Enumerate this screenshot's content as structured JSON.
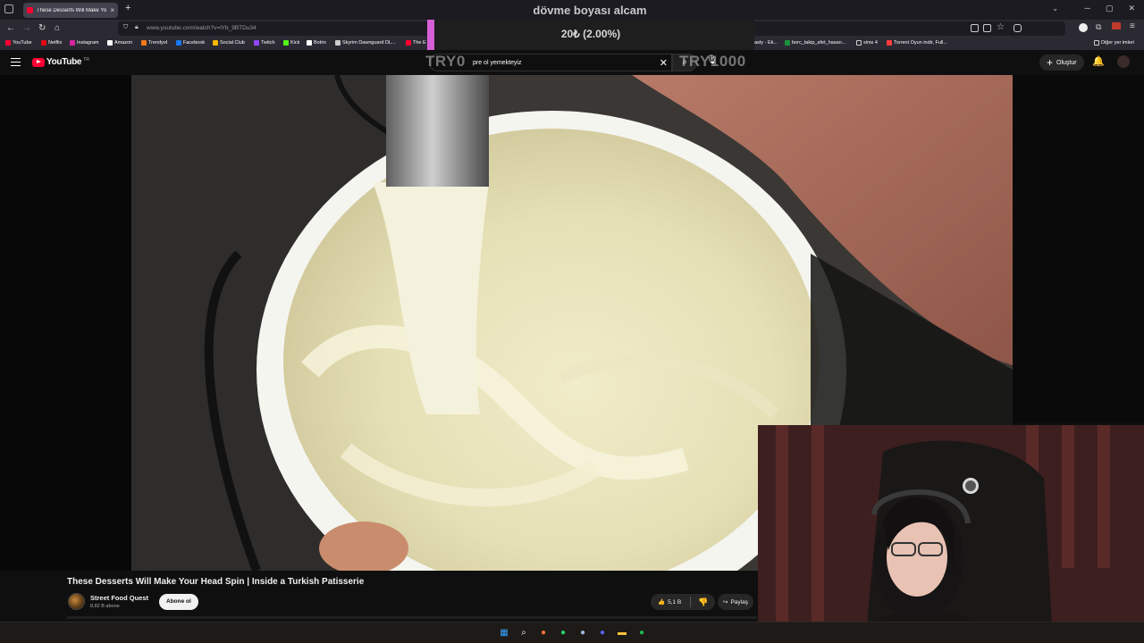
{
  "browser": {
    "tab_title": "These Desserts Will Make Your",
    "tab_close": "×",
    "new_tab": "+",
    "url_host": "www.youtube.com",
    "url_path": "/watch?v=lYb_9BTDu34",
    "window_controls": [
      "─",
      "▢",
      "✕"
    ],
    "nav": {
      "back": "←",
      "forward": "→",
      "reload": "↻",
      "home": "⌂"
    }
  },
  "bookmarks": [
    {
      "label": "YouTube",
      "color": "#ff0033"
    },
    {
      "label": "Netflix",
      "color": "#e50914"
    },
    {
      "label": "Instagram",
      "color": "#d6249f"
    },
    {
      "label": "Amazon",
      "color": "#ffffff"
    },
    {
      "label": "Trendyol",
      "color": "#f27a1a"
    },
    {
      "label": "Facebook",
      "color": "#1877f2"
    },
    {
      "label": "Social Club",
      "color": "#f5b700"
    },
    {
      "label": "Twitch",
      "color": "#9146ff"
    },
    {
      "label": "Kick",
      "color": "#53fc18"
    },
    {
      "label": "Botrix",
      "color": "#ffffff"
    },
    {
      "label": "Skyrim Dawnguard DL...",
      "color": "#cccccc"
    },
    {
      "label": "The E",
      "color": "#ff0033"
    },
    {
      "label": "asty - Ek...",
      "color": "#888888"
    },
    {
      "label": "borc_takip_afet_hasan...",
      "color": "#1d8f3a"
    },
    {
      "label": "sims 4",
      "color": "#cccccc"
    },
    {
      "label": "Torrent Oyun indir, Full...",
      "color": "#ff3b3b"
    }
  ],
  "other_bookmarks": "Diğer yer imleri",
  "youtube": {
    "logo_text": "YouTube",
    "logo_region": "TR",
    "search_value": "pre  ol yemekteyiz",
    "search_clear": "✕",
    "search_icon": "⌕",
    "mic_icon": "🎙",
    "create_label": "Oluştur",
    "create_plus": "+",
    "bell_icon": "🔔"
  },
  "overlay": {
    "title": "dövme boyası alcam",
    "donation_text": "20₺ (2.00%)",
    "progress_fraction": 0.02,
    "bar_color": "#d65fd6",
    "goal_start": "TRY0",
    "goal_end": "TRY1000"
  },
  "video": {
    "title": "These Desserts Will Make Your Head Spin | Inside a Turkish Patisserie",
    "channel_name": "Street Food Quest",
    "channel_subs": "8,82 B abone",
    "subscribe_label": "Abone ol",
    "like_count": "5,1 B",
    "like_icon": "👍",
    "dislike_icon": "👎",
    "share_label": "Paylaş",
    "share_icon": "↪"
  },
  "taskbar": {
    "icons": [
      {
        "name": "windows-start-icon",
        "color": "#3aa0ff",
        "glyph": "▦"
      },
      {
        "name": "search-icon",
        "color": "#ffffff",
        "glyph": "⌕"
      },
      {
        "name": "firefox-icon",
        "color": "#ff7139",
        "glyph": "●"
      },
      {
        "name": "whatsapp-icon",
        "color": "#25d366",
        "glyph": "●"
      },
      {
        "name": "steam-icon",
        "color": "#9fb8d6",
        "glyph": "●"
      },
      {
        "name": "discord-icon",
        "color": "#5865f2",
        "glyph": "●"
      },
      {
        "name": "file-explorer-icon",
        "color": "#f8c33a",
        "glyph": "▬"
      },
      {
        "name": "spotify-icon",
        "color": "#1db954",
        "glyph": "●"
      }
    ]
  }
}
